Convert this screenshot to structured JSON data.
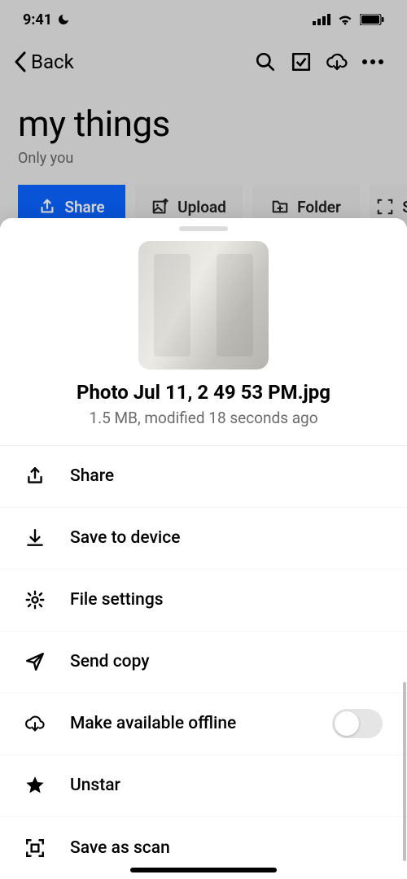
{
  "status": {
    "time": "9:41"
  },
  "nav": {
    "back": "Back"
  },
  "page": {
    "title": "my things",
    "subtitle": "Only you"
  },
  "chips": {
    "share": "Share",
    "upload": "Upload",
    "folder": "Folder",
    "scan": "S"
  },
  "sheet": {
    "filename": "Photo Jul 11, 2 49 53 PM.jpg",
    "meta": "1.5 MB, modified 18 seconds ago",
    "actions": {
      "share": "Share",
      "save": "Save to device",
      "settings": "File settings",
      "send": "Send copy",
      "offline": "Make available offline",
      "unstar": "Unstar",
      "scan": "Save as scan"
    }
  }
}
